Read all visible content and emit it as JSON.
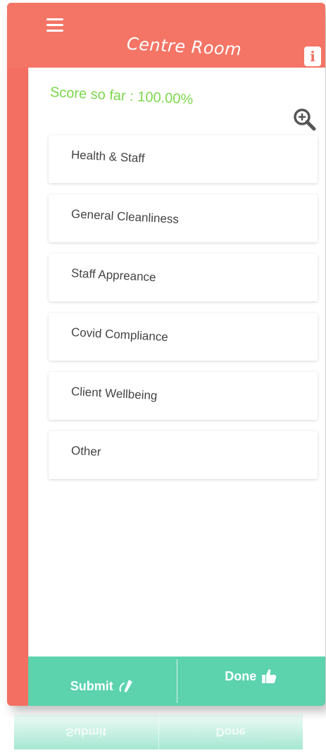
{
  "header": {
    "title": "Centre Room",
    "menu_icon": "hamburger-menu-icon",
    "info_icon": "info-icon",
    "info_glyph": "i"
  },
  "score": {
    "text": "Score so far : 100.00%"
  },
  "zoom_icon": "zoom-in-icon",
  "categories": [
    {
      "label": "Health & Staff"
    },
    {
      "label": "General Cleanliness"
    },
    {
      "label": "Staff Appreance"
    },
    {
      "label": "Covid Compliance"
    },
    {
      "label": "Client Wellbeing"
    },
    {
      "label": "Other"
    }
  ],
  "footer": {
    "submit_label": "Submit",
    "submit_icon": "pen-icon",
    "done_label": "Done",
    "done_icon": "thumbs-up-icon"
  },
  "colors": {
    "header": "#f47566",
    "footer": "#5cd3ad",
    "score_text": "#7bd84c"
  }
}
